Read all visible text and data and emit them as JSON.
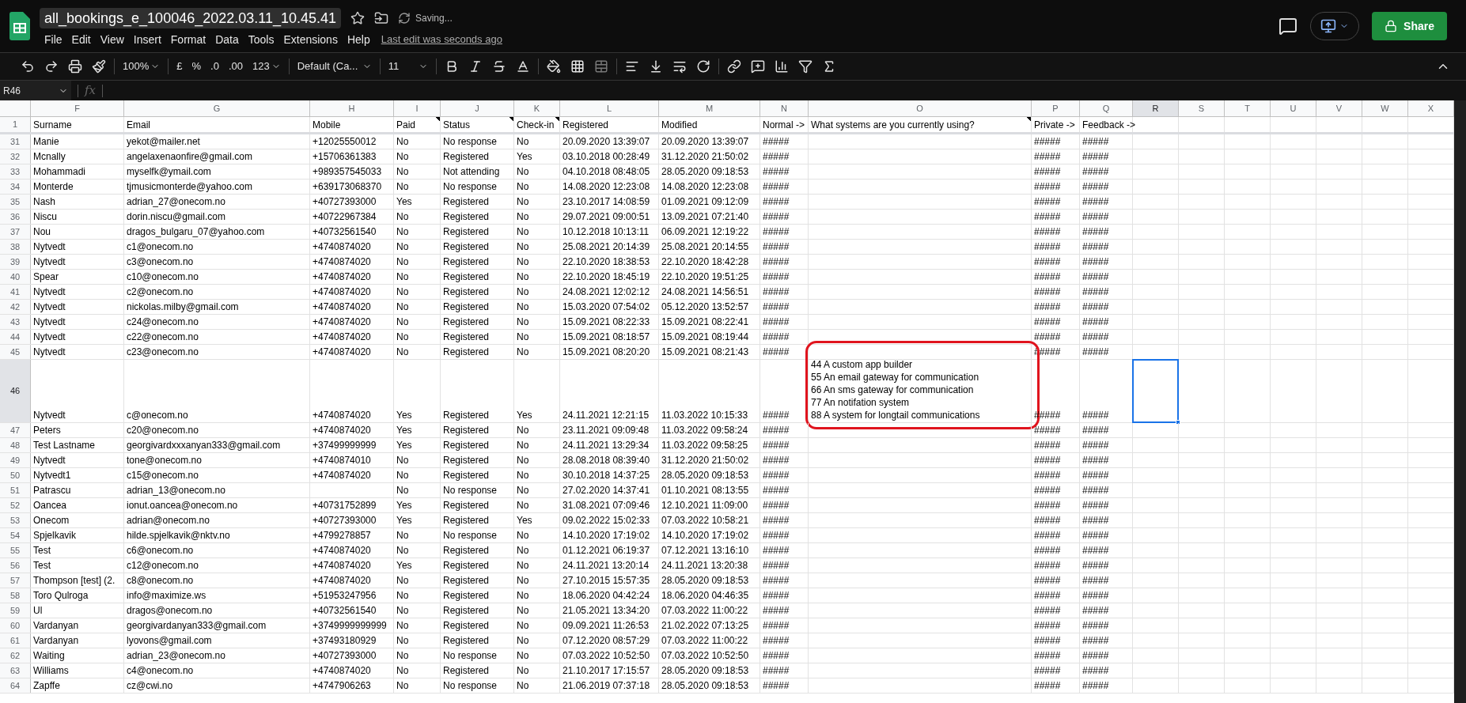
{
  "document": {
    "title": "all_bookings_e_100046_2022.03.11_10.45.41",
    "save_status": "Saving...",
    "last_edit": "Last edit was seconds ago"
  },
  "menu": [
    "File",
    "Edit",
    "View",
    "Insert",
    "Format",
    "Data",
    "Tools",
    "Extensions",
    "Help"
  ],
  "share_button": "Share",
  "toolbar": {
    "zoom": "100%",
    "currency": "£",
    "percent": "%",
    "decrease_decimal": ".0",
    "increase_decimal": ".00",
    "number_format": "123",
    "font": "Default (Ca...",
    "font_size": "11"
  },
  "formula_bar": {
    "name_box": "R46",
    "label": "fx"
  },
  "columns": [
    {
      "letter": "F",
      "heading": "Surname",
      "note": false,
      "selected": false
    },
    {
      "letter": "G",
      "heading": "Email",
      "note": false,
      "selected": false
    },
    {
      "letter": "H",
      "heading": "Mobile",
      "note": false,
      "selected": false
    },
    {
      "letter": "I",
      "heading": "Paid",
      "note": true,
      "selected": false
    },
    {
      "letter": "J",
      "heading": "Status",
      "note": true,
      "selected": false
    },
    {
      "letter": "K",
      "heading": "Check-in",
      "note": true,
      "selected": false
    },
    {
      "letter": "L",
      "heading": "Registered",
      "note": false,
      "selected": false
    },
    {
      "letter": "M",
      "heading": "Modified",
      "note": false,
      "selected": false
    },
    {
      "letter": "N",
      "heading": "Normal ->",
      "note": false,
      "selected": false
    },
    {
      "letter": "O",
      "heading": "What systems are you currently using?",
      "note": true,
      "selected": false
    },
    {
      "letter": "P",
      "heading": "Private ->",
      "note": false,
      "selected": false
    },
    {
      "letter": "Q",
      "heading": "Feedback ->",
      "note": false,
      "selected": false
    },
    {
      "letter": "R",
      "selected": true
    },
    {
      "letter": "S",
      "selected": false
    },
    {
      "letter": "T",
      "selected": false
    },
    {
      "letter": "U",
      "selected": false
    },
    {
      "letter": "V",
      "selected": false
    },
    {
      "letter": "W",
      "selected": false
    },
    {
      "letter": "X",
      "selected": false
    }
  ],
  "header_row_number": "1",
  "rows": [
    {
      "number": "31",
      "selected": false,
      "cells": {
        "F": "Manie",
        "G": "yekot@mailer.net",
        "H": "+12025550012",
        "I": "No",
        "J": "No response",
        "K": "No",
        "L": "20.09.2020 13:39:07",
        "M": "20.09.2020 13:39:07",
        "N": "#####",
        "P": "#####",
        "Q": "#####"
      }
    },
    {
      "number": "32",
      "selected": false,
      "cells": {
        "F": "Mcnally",
        "G": "angelaxenaonfire@gmail.com",
        "H": "+15706361383",
        "I": "No",
        "J": "Registered",
        "K": "Yes",
        "L": "03.10.2018 00:28:49",
        "M": "31.12.2020 21:50:02",
        "N": "#####",
        "P": "#####",
        "Q": "#####"
      }
    },
    {
      "number": "33",
      "selected": false,
      "cells": {
        "F": "Mohammadi",
        "G": "myselfk@ymail.com",
        "H": "+989357545033",
        "I": "No",
        "J": "Not attending",
        "K": "No",
        "L": "04.10.2018 08:48:05",
        "M": "28.05.2020 09:18:53",
        "N": "#####",
        "P": "#####",
        "Q": "#####"
      }
    },
    {
      "number": "34",
      "selected": false,
      "cells": {
        "F": "Monterde",
        "G": "tjmusicmonterde@yahoo.com",
        "H": "+639173068370",
        "I": "No",
        "J": "No response",
        "K": "No",
        "L": "14.08.2020 12:23:08",
        "M": "14.08.2020 12:23:08",
        "N": "#####",
        "P": "#####",
        "Q": "#####"
      }
    },
    {
      "number": "35",
      "selected": false,
      "cells": {
        "F": "Nash",
        "G": "adrian_27@onecom.no",
        "H": "+40727393000",
        "I": "Yes",
        "J": "Registered",
        "K": "No",
        "L": "23.10.2017 14:08:59",
        "M": "01.09.2021 09:12:09",
        "N": "#####",
        "P": "#####",
        "Q": "#####"
      }
    },
    {
      "number": "36",
      "selected": false,
      "cells": {
        "F": "Niscu",
        "G": "dorin.niscu@gmail.com",
        "H": "+40722967384",
        "I": "No",
        "J": "Registered",
        "K": "No",
        "L": "29.07.2021 09:00:51",
        "M": "13.09.2021 07:21:40",
        "N": "#####",
        "P": "#####",
        "Q": "#####"
      }
    },
    {
      "number": "37",
      "selected": false,
      "cells": {
        "F": "Nou",
        "G": "dragos_bulgaru_07@yahoo.com",
        "H": "+40732561540",
        "I": "No",
        "J": "Registered",
        "K": "No",
        "L": "10.12.2018 10:13:11",
        "M": "06.09.2021 12:19:22",
        "N": "#####",
        "P": "#####",
        "Q": "#####"
      }
    },
    {
      "number": "38",
      "selected": false,
      "cells": {
        "F": "Nytvedt",
        "G": "c1@onecom.no",
        "H": "+4740874020",
        "I": "No",
        "J": "Registered",
        "K": "No",
        "L": "25.08.2021 20:14:39",
        "M": "25.08.2021 20:14:55",
        "N": "#####",
        "P": "#####",
        "Q": "#####"
      }
    },
    {
      "number": "39",
      "selected": false,
      "cells": {
        "F": "Nytvedt",
        "G": "c3@onecom.no",
        "H": "+4740874020",
        "I": "No",
        "J": "Registered",
        "K": "No",
        "L": "22.10.2020 18:38:53",
        "M": "22.10.2020 18:42:28",
        "N": "#####",
        "P": "#####",
        "Q": "#####"
      }
    },
    {
      "number": "40",
      "selected": false,
      "cells": {
        "F": "Spear",
        "G": "c10@onecom.no",
        "H": "+4740874020",
        "I": "No",
        "J": "Registered",
        "K": "No",
        "L": "22.10.2020 18:45:19",
        "M": "22.10.2020 19:51:25",
        "N": "#####",
        "P": "#####",
        "Q": "#####"
      }
    },
    {
      "number": "41",
      "selected": false,
      "cells": {
        "F": "Nytvedt",
        "G": "c2@onecom.no",
        "H": "+4740874020",
        "I": "No",
        "J": "Registered",
        "K": "No",
        "L": "24.08.2021 12:02:12",
        "M": "24.08.2021 14:56:51",
        "N": "#####",
        "P": "#####",
        "Q": "#####"
      }
    },
    {
      "number": "42",
      "selected": false,
      "cells": {
        "F": "Nytvedt",
        "G": "nickolas.milby@gmail.com",
        "H": "+4740874020",
        "I": "No",
        "J": "Registered",
        "K": "No",
        "L": "15.03.2020 07:54:02",
        "M": "05.12.2020 13:52:57",
        "N": "#####",
        "P": "#####",
        "Q": "#####"
      }
    },
    {
      "number": "43",
      "selected": false,
      "cells": {
        "F": "Nytvedt",
        "G": "c24@onecom.no",
        "H": "+4740874020",
        "I": "No",
        "J": "Registered",
        "K": "No",
        "L": "15.09.2021 08:22:33",
        "M": "15.09.2021 08:22:41",
        "N": "#####",
        "P": "#####",
        "Q": "#####"
      }
    },
    {
      "number": "44",
      "selected": false,
      "cells": {
        "F": "Nytvedt",
        "G": "c22@onecom.no",
        "H": "+4740874020",
        "I": "No",
        "J": "Registered",
        "K": "No",
        "L": "15.09.2021 08:18:57",
        "M": "15.09.2021 08:19:44",
        "N": "#####",
        "P": "#####",
        "Q": "#####"
      }
    },
    {
      "number": "45",
      "selected": false,
      "cells": {
        "F": "Nytvedt",
        "G": "c23@onecom.no",
        "H": "+4740874020",
        "I": "No",
        "J": "Registered",
        "K": "No",
        "L": "15.09.2021 08:20:20",
        "M": "15.09.2021 08:21:43",
        "N": "#####",
        "P": "#####",
        "Q": "#####"
      }
    },
    {
      "number": "46",
      "selected": true,
      "tall": true,
      "highlighted": true,
      "cells": {
        "F": "Nytvedt",
        "G": "c@onecom.no",
        "H": "+4740874020",
        "I": "Yes",
        "J": "Registered",
        "K": "Yes",
        "L": "24.11.2021 12:21:15",
        "M": "11.03.2022 10:15:33",
        "N": "#####",
        "O": [
          "44 A custom app builder",
          "55 An email gateway for communication",
          "66 An sms gateway for communication",
          "77 An notifation system",
          "88 A system for longtail communications"
        ],
        "P": "#####",
        "Q": "#####"
      }
    },
    {
      "number": "47",
      "selected": false,
      "cells": {
        "F": "Peters",
        "G": "c20@onecom.no",
        "H": "+4740874020",
        "I": "Yes",
        "J": "Registered",
        "K": "No",
        "L": "23.11.2021 09:09:48",
        "M": "11.03.2022 09:58:24",
        "N": "#####",
        "P": "#####",
        "Q": "#####"
      }
    },
    {
      "number": "48",
      "selected": false,
      "cells": {
        "F": "Test Lastname",
        "G": "georgivardxxxanyan333@gmail.com",
        "H": "+37499999999",
        "I": "Yes",
        "J": "Registered",
        "K": "No",
        "L": "24.11.2021 13:29:34",
        "M": "11.03.2022 09:58:25",
        "N": "#####",
        "P": "#####",
        "Q": "#####"
      }
    },
    {
      "number": "49",
      "selected": false,
      "cells": {
        "F": "Nytvedt",
        "G": "tone@onecom.no",
        "H": "+4740874010",
        "I": "No",
        "J": "Registered",
        "K": "No",
        "L": "28.08.2018 08:39:40",
        "M": "31.12.2020 21:50:02",
        "N": "#####",
        "P": "#####",
        "Q": "#####"
      }
    },
    {
      "number": "50",
      "selected": false,
      "cells": {
        "F": "Nytvedt1",
        "G": "c15@onecom.no",
        "H": "+4740874020",
        "I": "No",
        "J": "Registered",
        "K": "No",
        "L": "30.10.2018 14:37:25",
        "M": "28.05.2020 09:18:53",
        "N": "#####",
        "P": "#####",
        "Q": "#####"
      }
    },
    {
      "number": "51",
      "selected": false,
      "cells": {
        "F": "Patrascu",
        "G": "adrian_13@onecom.no",
        "I": "No",
        "J": "No response",
        "K": "No",
        "L": "27.02.2020 14:37:41",
        "M": "01.10.2021 08:13:55",
        "N": "#####",
        "P": "#####",
        "Q": "#####"
      }
    },
    {
      "number": "52",
      "selected": false,
      "cells": {
        "F": "Oancea",
        "G": "ionut.oancea@onecom.no",
        "H": "+40731752899",
        "I": "Yes",
        "J": "Registered",
        "K": "No",
        "L": "31.08.2021 07:09:46",
        "M": "12.10.2021 11:09:00",
        "N": "#####",
        "P": "#####",
        "Q": "#####"
      }
    },
    {
      "number": "53",
      "selected": false,
      "cells": {
        "F": "Onecom",
        "G": "adrian@onecom.no",
        "H": "+40727393000",
        "I": "Yes",
        "J": "Registered",
        "K": "Yes",
        "L": "09.02.2022 15:02:33",
        "M": "07.03.2022 10:58:21",
        "N": "#####",
        "P": "#####",
        "Q": "#####"
      }
    },
    {
      "number": "54",
      "selected": false,
      "cells": {
        "F": "Spjelkavik",
        "G": "hilde.spjelkavik@nktv.no",
        "H": "+4799278857",
        "I": "No",
        "J": "No response",
        "K": "No",
        "L": "14.10.2020 17:19:02",
        "M": "14.10.2020 17:19:02",
        "N": "#####",
        "P": "#####",
        "Q": "#####"
      }
    },
    {
      "number": "55",
      "selected": false,
      "cells": {
        "F": "Test",
        "G": "c6@onecom.no",
        "H": "+4740874020",
        "I": "No",
        "J": "Registered",
        "K": "No",
        "L": "01.12.2021 06:19:37",
        "M": "07.12.2021 13:16:10",
        "N": "#####",
        "P": "#####",
        "Q": "#####"
      }
    },
    {
      "number": "56",
      "selected": false,
      "cells": {
        "F": "Test",
        "G": "c12@onecom.no",
        "H": "+4740874020",
        "I": "Yes",
        "J": "Registered",
        "K": "No",
        "L": "24.11.2021 13:20:14",
        "M": "24.11.2021 13:20:38",
        "N": "#####",
        "P": "#####",
        "Q": "#####"
      }
    },
    {
      "number": "57",
      "selected": false,
      "cells": {
        "F": "Thompson [test] (2.",
        "G": "c8@onecom.no",
        "H": "+4740874020",
        "I": "No",
        "J": "Registered",
        "K": "No",
        "L": "27.10.2015 15:57:35",
        "M": "28.05.2020 09:18:53",
        "N": "#####",
        "P": "#####",
        "Q": "#####"
      }
    },
    {
      "number": "58",
      "selected": false,
      "cells": {
        "F": "Toro Qulroga",
        "G": "info@maximize.ws",
        "H": "+51953247956",
        "I": "No",
        "J": "Registered",
        "K": "No",
        "L": "18.06.2020 04:42:24",
        "M": "18.06.2020 04:46:35",
        "N": "#####",
        "P": "#####",
        "Q": "#####"
      }
    },
    {
      "number": "59",
      "selected": false,
      "cells": {
        "F": "Ul",
        "G": "dragos@onecom.no",
        "H": "+40732561540",
        "I": "No",
        "J": "Registered",
        "K": "No",
        "L": "21.05.2021 13:34:20",
        "M": "07.03.2022 11:00:22",
        "N": "#####",
        "P": "#####",
        "Q": "#####"
      }
    },
    {
      "number": "60",
      "selected": false,
      "cells": {
        "F": "Vardanyan",
        "G": "georgivardanyan333@gmail.com",
        "H": "+3749999999999",
        "I": "No",
        "J": "Registered",
        "K": "No",
        "L": "09.09.2021 11:26:53",
        "M": "21.02.2022 07:13:25",
        "N": "#####",
        "P": "#####",
        "Q": "#####"
      }
    },
    {
      "number": "61",
      "selected": false,
      "cells": {
        "F": "Vardanyan",
        "G": "lyovons@gmail.com",
        "H": "+37493180929",
        "I": "No",
        "J": "Registered",
        "K": "No",
        "L": "07.12.2020 08:57:29",
        "M": "07.03.2022 11:00:22",
        "N": "#####",
        "P": "#####",
        "Q": "#####"
      }
    },
    {
      "number": "62",
      "selected": false,
      "cells": {
        "F": "Waiting",
        "G": "adrian_23@onecom.no",
        "H": "+40727393000",
        "I": "No",
        "J": "No response",
        "K": "No",
        "L": "07.03.2022 10:52:50",
        "M": "07.03.2022 10:52:50",
        "N": "#####",
        "P": "#####",
        "Q": "#####"
      }
    },
    {
      "number": "63",
      "selected": false,
      "cells": {
        "F": "Williams",
        "G": "c4@onecom.no",
        "H": "+4740874020",
        "I": "No",
        "J": "Registered",
        "K": "No",
        "L": "21.10.2017 17:15:57",
        "M": "28.05.2020 09:18:53",
        "N": "#####",
        "P": "#####",
        "Q": "#####"
      }
    },
    {
      "number": "64",
      "selected": false,
      "cells": {
        "F": "Zapffe",
        "G": "cz@cwi.no",
        "H": "+4747906263",
        "I": "No",
        "J": "No response",
        "K": "No",
        "L": "21.06.2019 07:37:18",
        "M": "28.05.2020 09:18:53",
        "N": "#####",
        "P": "#####",
        "Q": "#####"
      }
    }
  ]
}
